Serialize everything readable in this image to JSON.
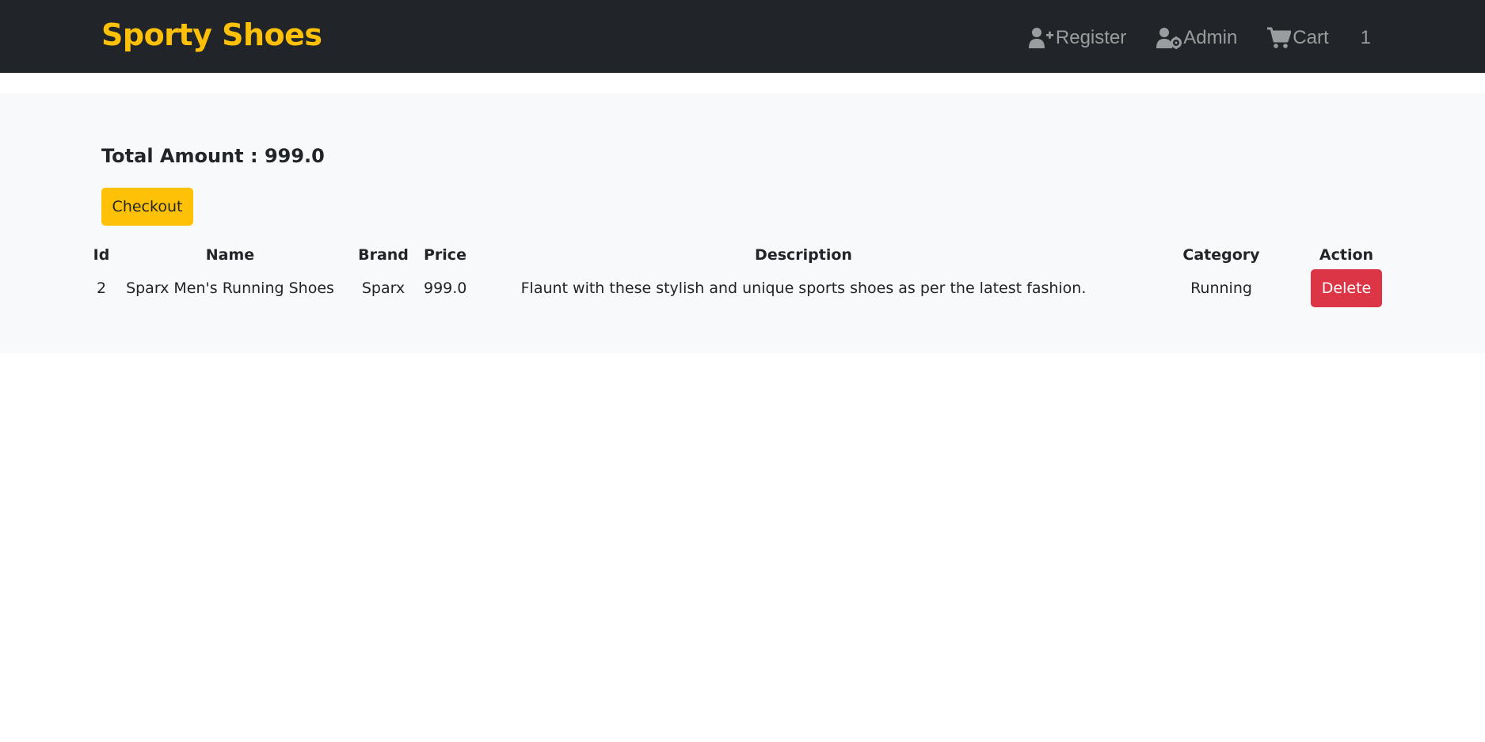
{
  "navbar": {
    "brand": "Sporty Shoes",
    "links": [
      {
        "label": "Register",
        "icon": "user-plus-icon"
      },
      {
        "label": "Admin",
        "icon": "user-gear-icon"
      },
      {
        "label": "Cart",
        "icon": "cart-icon"
      }
    ],
    "cart_count": "1"
  },
  "summary": {
    "total_label": "Total Amount : 999.0",
    "checkout_label": "Checkout"
  },
  "table": {
    "headers": [
      "Id",
      "Name",
      "Brand",
      "Price",
      "Description",
      "Category",
      "Action"
    ],
    "rows": [
      {
        "id": "2",
        "name": "Sparx Men's Running Shoes",
        "brand": "Sparx",
        "price": "999.0",
        "description": "Flaunt with these stylish and unique sports shoes as per the latest fashion.",
        "category": "Running",
        "action": "Delete"
      }
    ]
  },
  "colors": {
    "navbar_bg": "#212529",
    "brand": "#ffc107",
    "checkout": "#ffc107",
    "delete": "#dc3545",
    "content_bg": "#f8f9fa"
  }
}
